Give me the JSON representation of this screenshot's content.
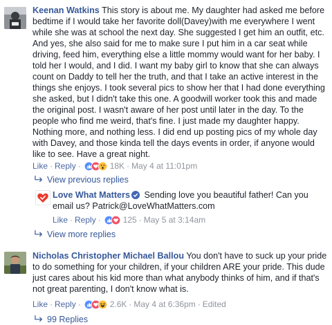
{
  "comments": [
    {
      "author": "Keenan Watkins",
      "text": "This story is about me. My daughter had asked me before bedtime if I would take her favorite doll(Davey)with me everywhere I went while she was at school the next day. She suggested I get him an outfit, etc. And yes, she also said for me to make sure I put him in a car seat while driving, feed him, everything else a little mommy would want for her baby. I told her I would, and I did. I want my baby girl to know that she can always count on Daddy to tell her the truth, and that I take an active interest in the things she enjoys. I took several pics to show her that I had done everything she asked, but I didn't take this one. A goodwill worker took this and made the original post. I wasn't aware of her post until later in the day. To the people who find me weird, that's fine. I just made my daughter happy. Nothing more, and nothing less. I did end up posting pics of my whole day with Davey, and those kinda tell the days events in order, if anyone would like to see. Have a great night.",
      "like": "Like",
      "reply": "Reply",
      "reactions_count": "18K",
      "timestamp": "May 4 at 11:01pm",
      "reaction_icons": [
        "like-icon",
        "love-icon",
        "wow-icon"
      ]
    },
    {
      "author": "Nicholas Christopher Michael Ballou",
      "text": "You don't have to suck up your pride to do something for your children, if your children ARE your pride. This dude just cares about his kid more than what anybody thinks of him, and if that's not great parenting, I don't know what is.",
      "like": "Like",
      "reply": "Reply",
      "reactions_count": "2.6K",
      "timestamp": "May 4 at 6:36pm",
      "edited": "Edited",
      "reaction_icons": [
        "like-icon",
        "love-icon",
        "haha-icon"
      ]
    }
  ],
  "view_previous_replies": "View previous replies",
  "view_more_replies": "View more replies",
  "reply": {
    "author": "Love What Matters",
    "text": "Sending love you beautiful father! Can you email us? Patrick@LoveWhatMatters.com",
    "like": "Like",
    "reply": "Reply",
    "reactions_count": "125",
    "timestamp": "May 5 at 3:14am",
    "reaction_icons": [
      "like-icon",
      "love-icon"
    ]
  },
  "bottom_replies_partial": "99 Replies",
  "colors": {
    "link": "#365899",
    "meta": "#90949c",
    "like_blue": "#5890ff",
    "love_red": "#f25268",
    "yellow": "#fcc03c",
    "brand_red": "#e9392b"
  }
}
